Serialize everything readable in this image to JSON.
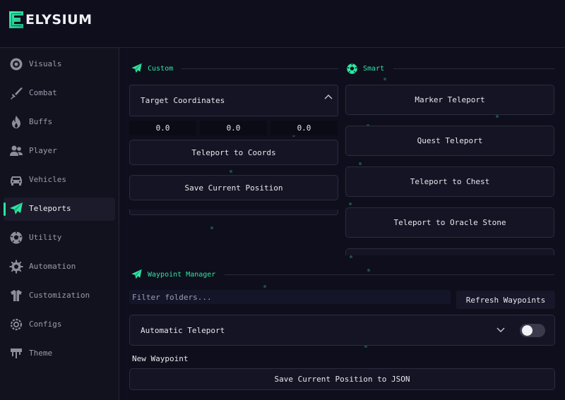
{
  "app": {
    "title": "ELYSIUM",
    "accent": "#2ee6a0"
  },
  "sidebar": {
    "items": [
      {
        "label": "Visuals",
        "icon": "eye-icon"
      },
      {
        "label": "Combat",
        "icon": "sword-icon"
      },
      {
        "label": "Buffs",
        "icon": "flame-icon"
      },
      {
        "label": "Player",
        "icon": "users-icon"
      },
      {
        "label": "Vehicles",
        "icon": "car-icon"
      },
      {
        "label": "Teleports",
        "icon": "paper-plane-icon",
        "active": true
      },
      {
        "label": "Utility",
        "icon": "soccer-ball-icon"
      },
      {
        "label": "Automation",
        "icon": "gear-icon"
      },
      {
        "label": "Customization",
        "icon": "shirt-icon"
      },
      {
        "label": "Configs",
        "icon": "cog-icon"
      },
      {
        "label": "Theme",
        "icon": "paint-drip-icon"
      }
    ]
  },
  "custom": {
    "title": "Custom",
    "target_label": "Target Coordinates",
    "coords": [
      "0.0",
      "0.0",
      "0.0"
    ],
    "teleport_button": "Teleport to Coords",
    "save_button": "Save Current Position"
  },
  "smart": {
    "title": "Smart",
    "buttons": [
      "Marker Teleport",
      "Quest Teleport",
      "Teleport to Chest",
      "Teleport to Oracle Stone"
    ]
  },
  "waypoints": {
    "title": "Waypoint Manager",
    "filter_placeholder": "Filter folders...",
    "refresh_button": "Refresh Waypoints",
    "auto_teleport_label": "Automatic Teleport",
    "auto_teleport_enabled": false,
    "new_waypoint_value": "New Waypoint",
    "save_json_button": "Save Current Position to JSON"
  }
}
